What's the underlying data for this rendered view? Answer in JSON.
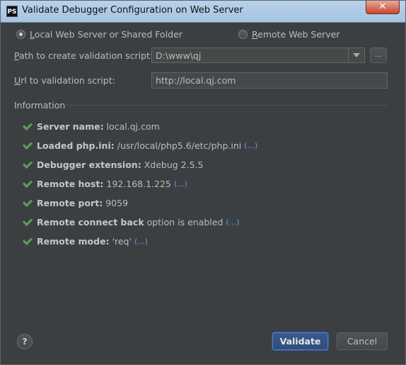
{
  "window": {
    "title": "Validate Debugger Configuration on Web Server",
    "app_icon": "PS",
    "close_glyph": "✕"
  },
  "mode": {
    "local_label": "Local Web Server or Shared Folder",
    "remote_label": "Remote Web Server",
    "selected": "local"
  },
  "path": {
    "label": "Path to create validation script:",
    "value": "D:\\www\\qj",
    "browse_label": "..."
  },
  "url": {
    "label": "Url to validation script:",
    "value": "http://local.qj.com"
  },
  "information": {
    "title": "Information",
    "items": [
      {
        "label": "Server name:",
        "value": "local.qj.com",
        "more": ""
      },
      {
        "label": "Loaded php.ini:",
        "value": "/usr/local/php5.6/etc/php.ini",
        "more": "(...)"
      },
      {
        "label": "Debugger extension:",
        "value": "Xdebug 2.5.5",
        "more": ""
      },
      {
        "label": "Remote host:",
        "value": "192.168.1.225",
        "more": "(...)"
      },
      {
        "label": "Remote port:",
        "value": "9059",
        "more": ""
      },
      {
        "label": "Remote connect back",
        "value": "option is enabled",
        "more": "(...)"
      },
      {
        "label": "Remote mode:",
        "value": "'req'",
        "more": "(...)"
      }
    ]
  },
  "buttons": {
    "help": "?",
    "validate": "Validate",
    "cancel": "Cancel"
  },
  "colors": {
    "check": "#57a357",
    "link": "#589df6",
    "accent": "#2f4d7c"
  }
}
